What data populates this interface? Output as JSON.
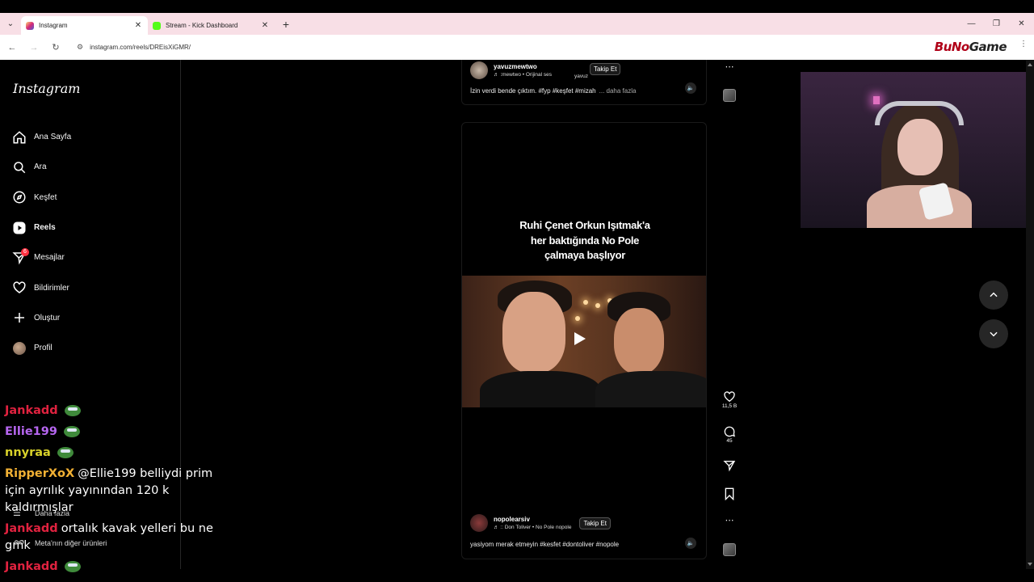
{
  "browser": {
    "tabs": [
      {
        "title": "Instagram",
        "favicon_color": "#e1306c"
      },
      {
        "title": "Stream - Kick Dashboard",
        "favicon_color": "#53fc18"
      }
    ],
    "url": "instagram.com/reels/DREisXiGMR/",
    "brand_overlay": {
      "part1": "BuNo",
      "part2": "Game"
    }
  },
  "sidebar": {
    "logo": "Instagram",
    "items": [
      {
        "label": "Ana Sayfa",
        "icon": "home-icon"
      },
      {
        "label": "Ara",
        "icon": "search-icon"
      },
      {
        "label": "Keşfet",
        "icon": "compass-icon"
      },
      {
        "label": "Reels",
        "icon": "reels-icon"
      },
      {
        "label": "Mesajlar",
        "icon": "messenger-icon",
        "badge": "6"
      },
      {
        "label": "Bildirimler",
        "icon": "heart-icon"
      },
      {
        "label": "Oluştur",
        "icon": "plus-icon"
      },
      {
        "label": "Profil",
        "icon": "avatar"
      }
    ],
    "more": "Daha fazla",
    "meta": "Meta'nın diğer ürünleri"
  },
  "chat": {
    "messages": [
      {
        "user": "Jankadd",
        "color": "#e0223f",
        "text": "",
        "emote": true
      },
      {
        "user": "Ellie199",
        "color": "#b666f0",
        "text": "",
        "emote": true
      },
      {
        "user": "nnyraa",
        "color": "#d8d12a",
        "text": "",
        "emote": true
      },
      {
        "user": "RipperXoX",
        "color": "#f2b134",
        "text": "@Ellie199 belliydi prim için ayrılık yayınından 120 k kaldırmışlar",
        "emote": false
      },
      {
        "user": "Jankadd",
        "color": "#e0223f",
        "text": "ortalık kavak yelleri bu ne gmk",
        "emote": false
      },
      {
        "user": "Jankadd",
        "color": "#e0223f",
        "text": "",
        "emote": true
      }
    ]
  },
  "post_top": {
    "username": "yavuzmewtwo",
    "audio": ":mewtwo • Orijinal ses",
    "audio_extra": "yavuz",
    "follow_label": "Takip Et",
    "caption": "İzin verdi bende çıktım. #fyp #keşfet #mizah",
    "more_label": "... daha fazla"
  },
  "reel": {
    "overlay_text": [
      "Ruhi Çenet Orkun Işıtmak'a",
      "her baktığında No Pole",
      "çalmaya başlıyor"
    ],
    "username": "nopolearsiv",
    "audio": "♬ :: Don Toliver • No Pole",
    "audio_extra": "nopole",
    "follow_label": "Takip Et",
    "caption": "yasiyom merak etmeyin #kesfet #dontoliver #nopole",
    "likes": "11,5 B",
    "comments": "45"
  }
}
